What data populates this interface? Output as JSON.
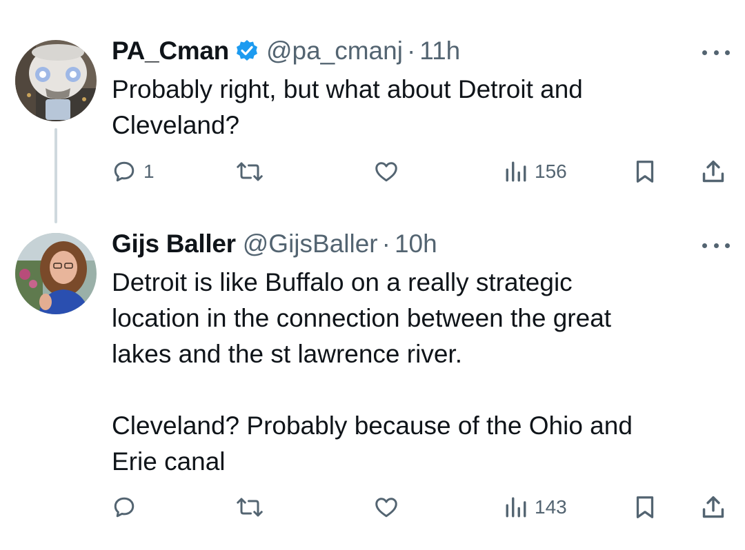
{
  "tweets": [
    {
      "author_name": "PA_Cman",
      "verified": true,
      "handle": "@pa_cmanj",
      "separator": "·",
      "time": "11h",
      "avatar_icon": "funko-figure-avatar",
      "text": "Probably right, but what about Detroit and\nCleveland?",
      "actions": {
        "reply_count": "1",
        "retweet_count": "",
        "like_count": "",
        "views_count": "156"
      }
    },
    {
      "author_name": "Gijs Baller",
      "verified": false,
      "handle": "@GijsBaller",
      "separator": "·",
      "time": "10h",
      "avatar_icon": "person-photo-avatar",
      "text": "Detroit is like Buffalo on a really strategic\nlocation in the connection between the great\nlakes and the st lawrence river.\n\nCleveland? Probably because of the Ohio and\nErie canal",
      "actions": {
        "reply_count": "",
        "retweet_count": "",
        "like_count": "",
        "views_count": "143"
      }
    }
  ],
  "icons": {
    "reply": "reply-icon",
    "retweet": "retweet-icon",
    "like": "heart-icon",
    "views": "views-bar-chart-icon",
    "bookmark": "bookmark-icon",
    "share": "share-icon",
    "more": "more-options-icon",
    "verified": "verified-badge-icon"
  },
  "colors": {
    "text": "#0f1419",
    "muted": "#536471",
    "verified_blue": "#1d9bf0",
    "thread_line": "#cfd9de"
  }
}
